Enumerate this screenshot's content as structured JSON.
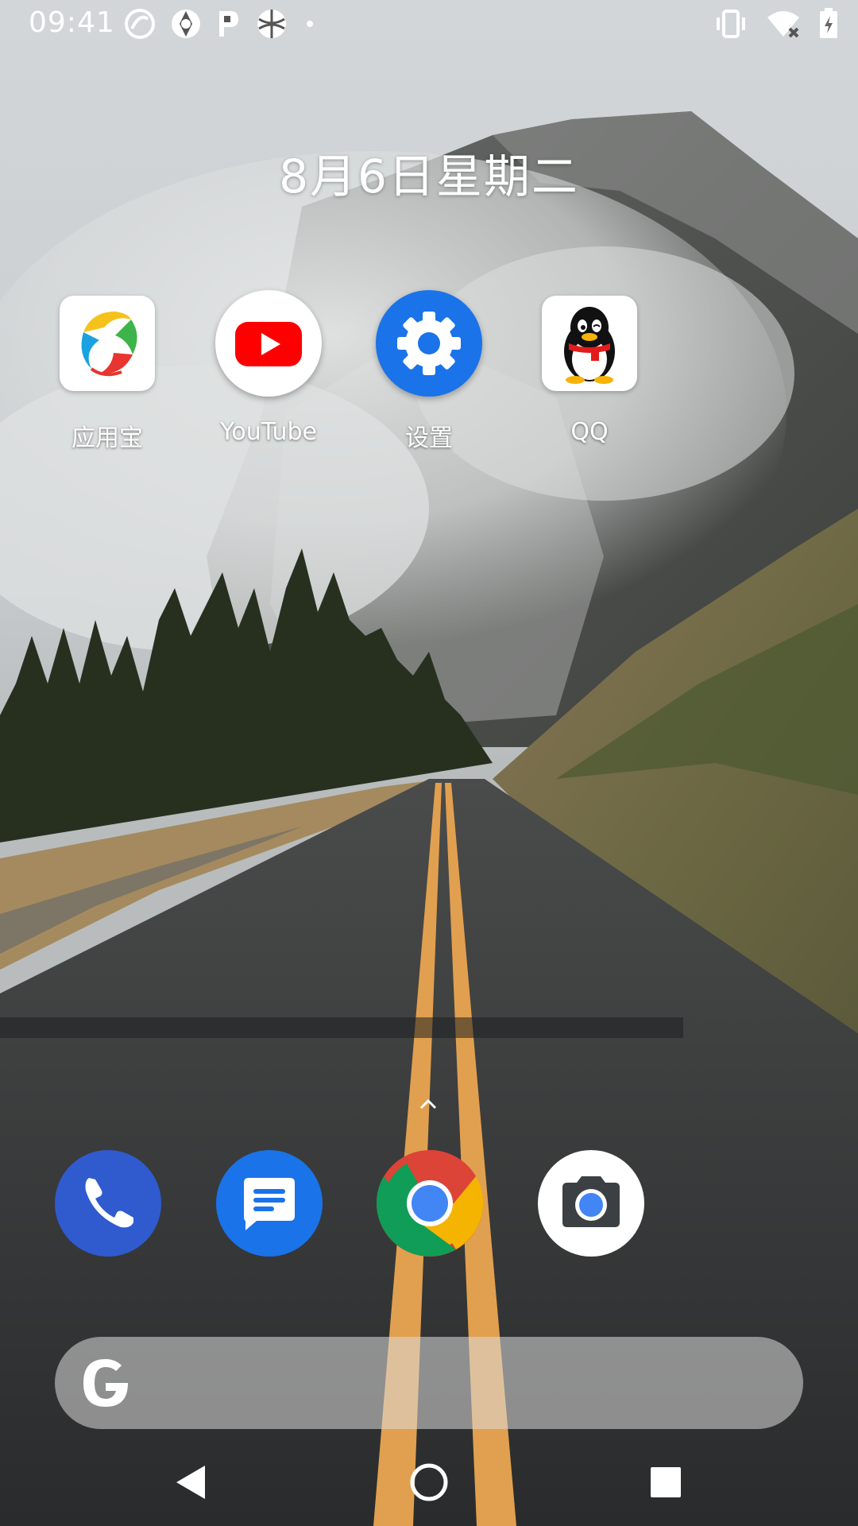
{
  "status_bar": {
    "time": "09:41",
    "notification_icons": [
      "sync-icon",
      "aperture-icon",
      "p-badge-icon",
      "basketball-icon",
      "more-dot-icon"
    ],
    "system_icons": [
      "vibrate-icon",
      "wifi-off-icon",
      "battery-charging-icon"
    ]
  },
  "date": "8月6日星期二",
  "apps": [
    {
      "label": "应用宝",
      "icon": "yingyongbao-icon"
    },
    {
      "label": "YouTube",
      "icon": "youtube-icon"
    },
    {
      "label": "设置",
      "icon": "settings-gear-icon"
    },
    {
      "label": "QQ",
      "icon": "qq-penguin-icon"
    }
  ],
  "dock": [
    {
      "name": "phone",
      "icon": "phone-icon"
    },
    {
      "name": "messages",
      "icon": "messages-icon"
    },
    {
      "name": "chrome",
      "icon": "chrome-icon"
    },
    {
      "name": "camera",
      "icon": "camera-icon"
    }
  ],
  "search": {
    "icon": "google-g-icon"
  },
  "nav": {
    "back": "back-icon",
    "home": "home-icon",
    "recents": "recents-icon"
  },
  "colors": {
    "youtube_red": "#FF0000",
    "settings_blue": "#1A73E8",
    "phone_blue": "#2F5BCF",
    "messages_blue": "#1A73E8",
    "chrome_red": "#DB4437",
    "chrome_yellow": "#F4B400",
    "chrome_green": "#0F9D58",
    "chrome_blue": "#4285F4"
  }
}
